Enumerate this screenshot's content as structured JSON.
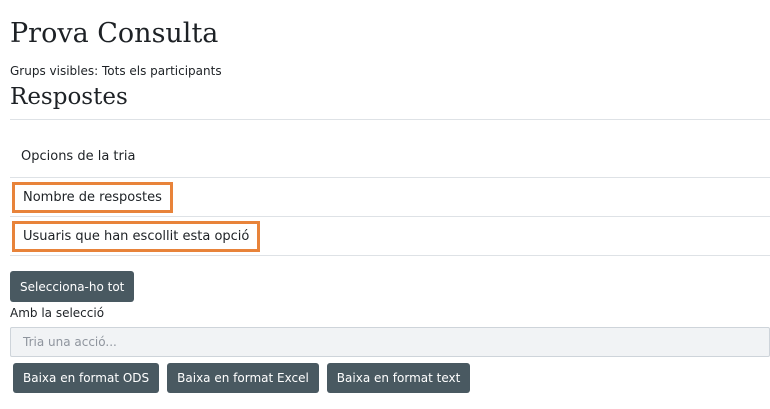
{
  "page": {
    "title": "Prova Consulta",
    "groups_visible": "Grups visibles: Tots els participants",
    "subtitle": "Respostes"
  },
  "results_table": {
    "header": "Opcions de la tria",
    "rows": [
      {
        "label": "Nombre de respostes"
      },
      {
        "label": "Usuaris que han escollit esta opció"
      }
    ]
  },
  "actions": {
    "select_all_label": "Selecciona-ho tot",
    "with_selection_label": "Amb la selecció",
    "action_placeholder": "Tria una acció...",
    "downloads": [
      "Baixa en format ODS",
      "Baixa en format Excel",
      "Baixa en format text"
    ]
  },
  "colors": {
    "button_bg": "#495961",
    "highlight_border": "#e8833a"
  }
}
